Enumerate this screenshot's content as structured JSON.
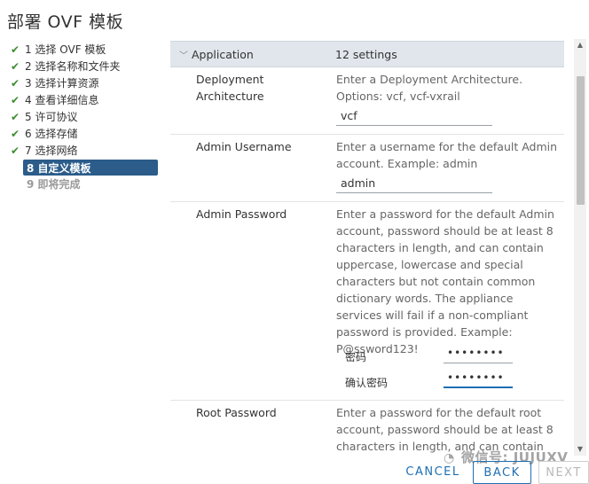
{
  "window": {
    "title": "部署 OVF 模板"
  },
  "steps": [
    {
      "label": "1 选择 OVF 模板",
      "state": "done"
    },
    {
      "label": "2 选择名称和文件夹",
      "state": "done"
    },
    {
      "label": "3 选择计算资源",
      "state": "done"
    },
    {
      "label": "4 查看详细信息",
      "state": "done"
    },
    {
      "label": "5 许可协议",
      "state": "done"
    },
    {
      "label": "6 选择存储",
      "state": "done"
    },
    {
      "label": "7 选择网络",
      "state": "done"
    },
    {
      "label": "8 自定义模板",
      "state": "active"
    },
    {
      "label": "9 即将完成",
      "state": "disabled"
    }
  ],
  "section": {
    "title": "Application",
    "count": "12 settings"
  },
  "settings": {
    "deployment": {
      "name": "Deployment Architecture",
      "desc": "Enter a Deployment Architecture. Options: vcf, vcf-vxrail",
      "value": "vcf"
    },
    "admin_username": {
      "name": "Admin Username",
      "desc": "Enter a username for the default Admin account. Example: admin",
      "value": "admin"
    },
    "admin_password": {
      "name": "Admin Password",
      "desc": "Enter a password for the default Admin account, password should be at least 8 characters in length, and can contain uppercase, lowercase and special characters but not contain common dictionary words. The appliance services will fail if a non-compliant password is provided. Example: P@ssword123!",
      "password_label": "密码",
      "password_value": "••••••••",
      "confirm_label": "确认密码",
      "confirm_value": "••••••••"
    },
    "root_password": {
      "name": "Root Password",
      "desc": "Enter a password for the default root account, password should be at least 8 characters in length, and can contain"
    }
  },
  "footer": {
    "cancel": "CANCEL",
    "back": "BACK",
    "next": "NEXT"
  },
  "watermark": {
    "text": "微信号: JUJUXV",
    "icon": "wechat-icon"
  },
  "colors": {
    "active_step": "#2b5c8a",
    "check": "#3c8d2f",
    "link": "#1f6fb2"
  }
}
